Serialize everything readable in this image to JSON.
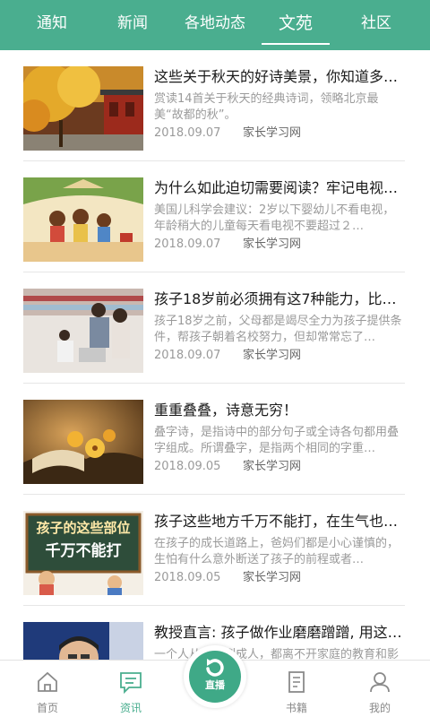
{
  "colors": {
    "accent": "#4aae8f",
    "white": "#ffffff",
    "muted": "#9a9a9a"
  },
  "top_tabs": [
    {
      "label": "通知",
      "active": false
    },
    {
      "label": "新闻",
      "active": false
    },
    {
      "label": "各地动态",
      "active": false
    },
    {
      "label": "文苑",
      "active": true
    },
    {
      "label": "社区",
      "active": false
    }
  ],
  "articles": [
    {
      "title": "这些关于秋天的好诗美景，你知道多…",
      "desc": "赏读14首关于秋天的经典诗词，领略北京最美“故都的秋”。",
      "date": "2018.09.07",
      "source": "家长学习网",
      "thumb": "autumn-temple-image"
    },
    {
      "title": "为什么如此迫切需要阅读？牢记电视…",
      "desc": "美国儿科学会建议：2岁以下婴幼儿不看电视，年龄稍大的儿童每天看电视不要超过２…",
      "date": "2018.09.07",
      "source": "家长学习网",
      "thumb": "children-reading-illustration"
    },
    {
      "title": "孩子18岁前必须拥有这7种能力，比…",
      "desc": "孩子18岁之前，父母都是竭尽全力为孩子提供条件，帮孩子朝着名校努力，但却常常忘了…",
      "date": "2018.09.07",
      "source": "家长学习网",
      "thumb": "family-shopping-photo"
    },
    {
      "title": "重重叠叠，诗意无穷！",
      "desc": "叠字诗，是指诗中的部分句子或全诗各句都用叠字组成。所谓叠字，是指两个相同的字重…",
      "date": "2018.09.05",
      "source": "家长学习网",
      "thumb": "book-flowers-photo"
    },
    {
      "title": "孩子这些地方千万不能打，在生气也…",
      "desc": "在孩子的成长道路上，爸妈们都是小心谨慎的，生怕有什么意外断送了孩子的前程或者…",
      "date": "2018.09.05",
      "source": "家长学习网",
      "thumb": "chalkboard-sign-image",
      "thumb_text_1": "孩子的这些部位",
      "thumb_text_2": "千万不能打"
    },
    {
      "title": "教授直言: 孩子做作业磨磨蹭蹭, 用这…",
      "desc": "一个人从出生到成人，都离不开家庭的教育和影响…",
      "date": "",
      "source": "",
      "thumb": "professor-portrait-photo"
    }
  ],
  "bottom_tabs": [
    {
      "label": "首页",
      "icon": "home-icon",
      "active": false
    },
    {
      "label": "资讯",
      "icon": "news-icon",
      "active": true
    },
    {
      "label": "书籍",
      "icon": "book-icon",
      "active": false
    },
    {
      "label": "我的",
      "icon": "user-icon",
      "active": false
    }
  ],
  "live_button": {
    "label": "直播",
    "icon": "live-refresh-icon"
  }
}
